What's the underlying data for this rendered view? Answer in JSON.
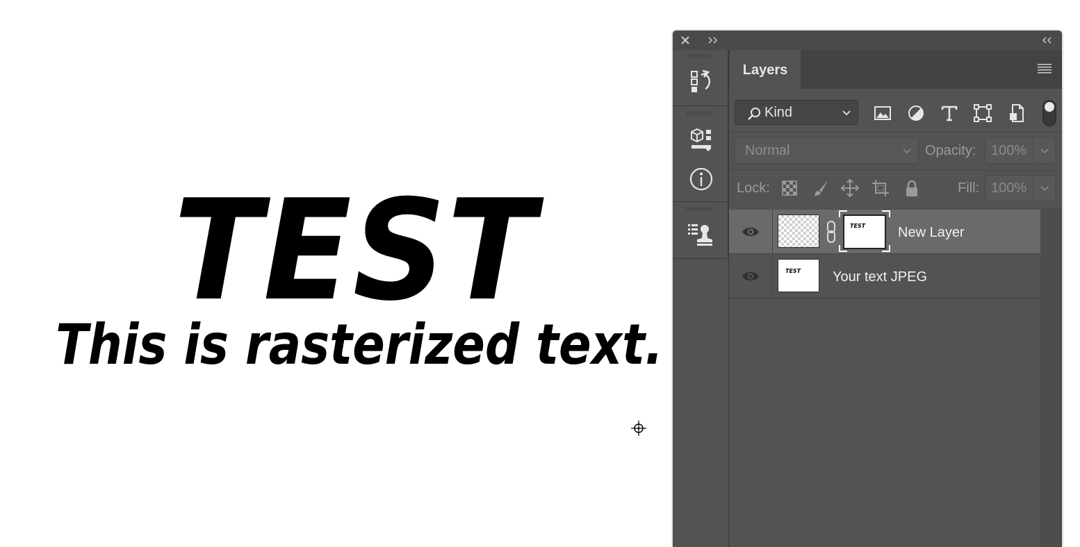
{
  "canvas": {
    "headline": "TEST",
    "subline": "This is rasterized text."
  },
  "panel": {
    "tab_label": "Layers",
    "dock_tools": [
      "history-icon",
      "3d-properties-icon",
      "info-icon",
      "clone-source-icon"
    ],
    "filter": {
      "kind_label": "Kind",
      "icons": [
        "image-filter-icon",
        "adjustment-filter-icon",
        "type-filter-icon",
        "shape-filter-icon",
        "smart-object-filter-icon"
      ]
    },
    "blend": {
      "mode": "Normal",
      "opacity_label": "Opacity:",
      "opacity_value": "100%"
    },
    "lock": {
      "label": "Lock:",
      "icons": [
        "lock-transparent-pixels-icon",
        "lock-image-pixels-icon",
        "lock-position-icon",
        "lock-artboard-icon",
        "lock-all-icon"
      ],
      "fill_label": "Fill:",
      "fill_value": "100%"
    },
    "layers": [
      {
        "name": "New Layer",
        "visible": true,
        "selected": true,
        "has_mask": true,
        "thumb_text": "TEST"
      },
      {
        "name": "Your text JPEG",
        "visible": true,
        "selected": false,
        "has_mask": false,
        "thumb_text": "TEST"
      }
    ]
  },
  "colors": {
    "panel_bg": "#535353",
    "selected_row": "#6a6a6a",
    "canvas_bg": "#ffffff"
  }
}
